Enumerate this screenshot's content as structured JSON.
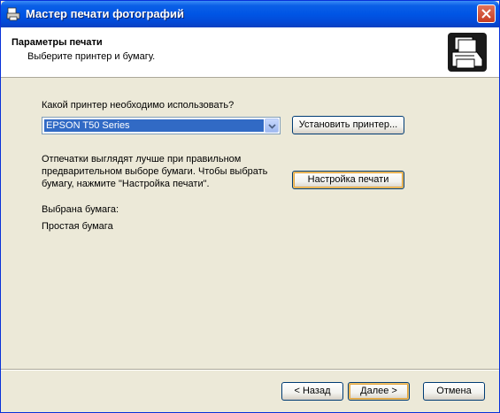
{
  "window": {
    "title": "Мастер печати фотографий",
    "app_icon": "print-wizard-icon",
    "close_icon": "close-icon"
  },
  "header": {
    "title": "Параметры печати",
    "subtitle": "Выберите принтер и бумагу.",
    "icon": "printer-photos-icon"
  },
  "main": {
    "printer_question": "Какой принтер необходимо использовать?",
    "printer_select_value": "EPSON T50 Series",
    "install_printer_label": "Установить принтер...",
    "paper_hint_line1": "Отпечатки выглядят лучше при правильном",
    "paper_hint_line2": "предварительном выборе бумаги. Чтобы выбрать",
    "paper_hint_line3": "бумагу, нажмите \"Настройка печати\".",
    "print_settings_label": "Настройка печати",
    "selected_paper_label": "Выбрана бумага:",
    "selected_paper_value": "Простая бумага"
  },
  "footer": {
    "back_label": "< Назад",
    "next_label": "Далее >",
    "cancel_label": "Отмена"
  },
  "colors": {
    "titlebar": "#0055e5",
    "selection": "#316ac5",
    "dialog_bg": "#ece9d8"
  }
}
